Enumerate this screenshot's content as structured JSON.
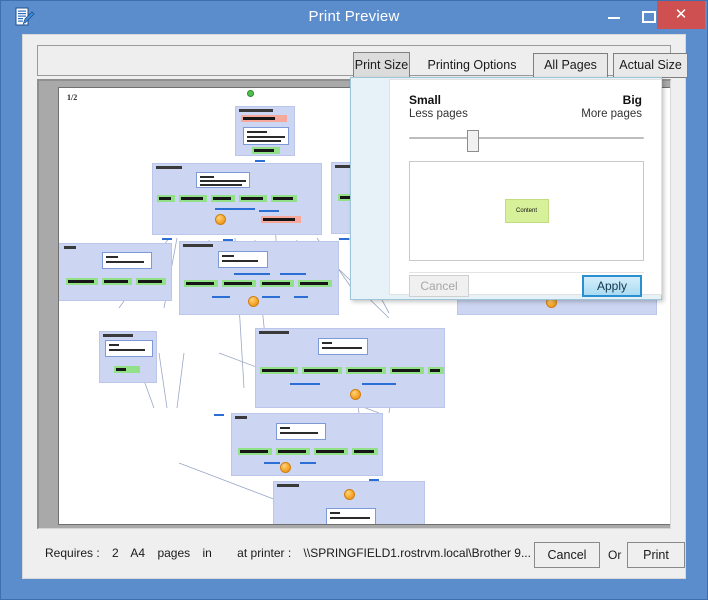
{
  "window": {
    "title": "Print Preview",
    "app_icon": "document-pen-icon",
    "minimize_label": "–",
    "maximize_label": "□",
    "close_label": "✕",
    "close_color": "#cf5050",
    "titlebar_color": "#5b8ccc"
  },
  "toolbar": {
    "print_size": "Print Size",
    "printing_options": "Printing Options",
    "all_pages": "All Pages",
    "actual_size": "Actual Size"
  },
  "preview": {
    "page_label": "1/2"
  },
  "dialog": {
    "small_label": "Small",
    "big_label": "Big",
    "less_pages_label": "Less pages",
    "more_pages_label": "More pages",
    "slider_value": 25,
    "content_chip_label": "Content",
    "content_chip_color": "#d7f09a",
    "cancel_label": "Cancel",
    "cancel_disabled": true,
    "apply_label": "Apply",
    "apply_accent": "#2a8fd0"
  },
  "status": {
    "requires_label": "Requires :",
    "page_count": "2",
    "paper_size": "A4",
    "pages_word": "pages",
    "in_word": "in",
    "at_printer_label": "at printer :",
    "printer_name": "\\\\SPRINGFIELD1.rostrvm.local\\Brother 9...",
    "cancel_label": "Cancel",
    "or_label": "Or",
    "print_label": "Print"
  },
  "diagram": {
    "node_fill": "#ccd5f2",
    "row_green": "#92e088",
    "row_pink": "#f6a99a",
    "connector_color": "#9aa7c6"
  }
}
